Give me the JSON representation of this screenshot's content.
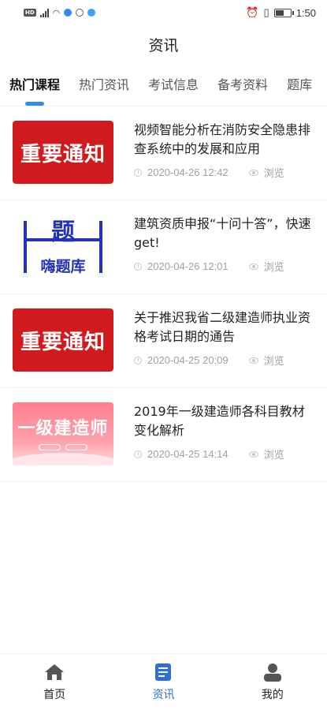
{
  "status_bar": {
    "badge": "HD",
    "time": "1:50"
  },
  "header": {
    "title": "资讯"
  },
  "tabs": [
    {
      "label": "热门课程",
      "active": true
    },
    {
      "label": "热门资讯",
      "active": false
    },
    {
      "label": "考试信息",
      "active": false
    },
    {
      "label": "备考资料",
      "active": false
    },
    {
      "label": "题库",
      "active": false
    }
  ],
  "news": [
    {
      "title": "视频智能分析在消防安全隐患排查系统中的发展和应用",
      "date": "2020-04-26 12:42",
      "views_label": "浏览",
      "thumb_text": "重要通知"
    },
    {
      "title": "建筑资质申报“十问十答”，快速get!",
      "date": "2020-04-26 12:01",
      "views_label": "浏览",
      "thumb_char": "题",
      "thumb_text": "嗨题库"
    },
    {
      "title": "关于推迟我省二级建造师执业资格考试日期的通告",
      "date": "2020-04-25 20:09",
      "views_label": "浏览",
      "thumb_text": "重要通知"
    },
    {
      "title": "2019年一级建造师各科目教材变化解析",
      "date": "2020-04-25 14:14",
      "views_label": "浏览",
      "thumb_text": "一级建造师"
    }
  ],
  "bottom_nav": [
    {
      "label": "首页",
      "icon": "home-icon",
      "active": false
    },
    {
      "label": "资讯",
      "icon": "news-icon",
      "active": true
    },
    {
      "label": "我的",
      "icon": "profile-icon",
      "active": false
    }
  ],
  "colors": {
    "accent": "#2f8cf0",
    "nav_active": "#2f6fd6",
    "notice_red": "#d11a1e",
    "tiku_blue": "#2233b8"
  }
}
